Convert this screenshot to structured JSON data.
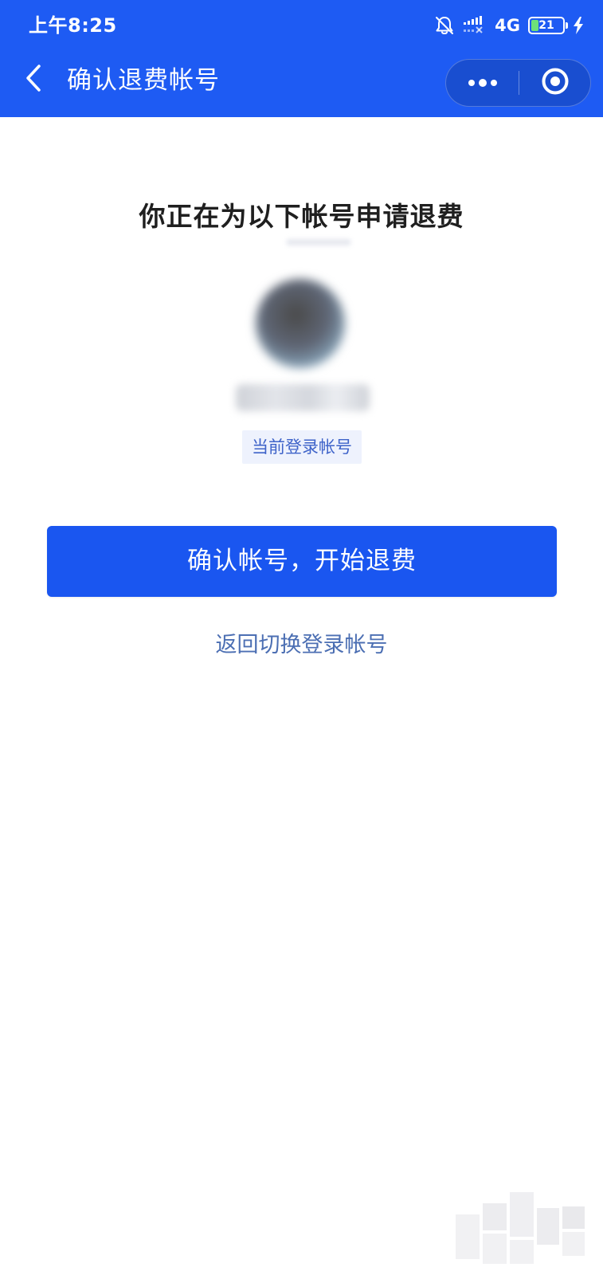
{
  "status_bar": {
    "time": "上午8:25",
    "network": "4G",
    "battery_level": "21",
    "icons": [
      "bell-muted-icon",
      "signal-icon",
      "charging-icon"
    ]
  },
  "nav": {
    "title": "确认退费帐号",
    "back_icon": "chevron-left-icon",
    "more_icon": "more-dots-icon",
    "close_icon": "target-circle-icon"
  },
  "main": {
    "headline": "你正在为以下帐号申请退费",
    "current_login_tag": "当前登录帐号",
    "confirm_button": "确认帐号，开始退费",
    "switch_link": "返回切换登录帐号"
  },
  "colors": {
    "brand_blue": "#1e5bf3",
    "button_blue": "#1a56f0",
    "link_blue": "#4c6fb3",
    "tag_bg": "#eef2fd"
  }
}
